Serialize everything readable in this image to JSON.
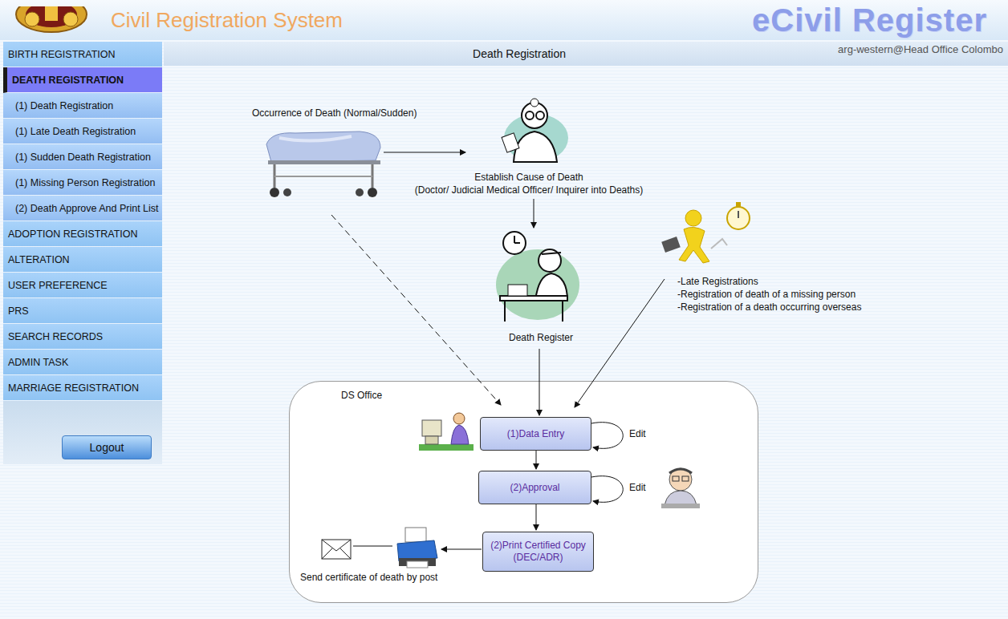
{
  "header": {
    "title": "Civil Registration System",
    "brand": "eCivil Register"
  },
  "sidebar": {
    "items": [
      {
        "label": "BIRTH REGISTRATION",
        "kind": "section",
        "selected": false
      },
      {
        "label": "DEATH REGISTRATION",
        "kind": "section",
        "selected": true
      },
      {
        "label": "(1) Death Registration",
        "kind": "sub",
        "selected": false
      },
      {
        "label": "(1) Late Death Registration",
        "kind": "sub",
        "selected": false
      },
      {
        "label": "(1) Sudden Death Registration",
        "kind": "sub",
        "selected": false
      },
      {
        "label": "(1) Missing Person Registration",
        "kind": "sub",
        "selected": false
      },
      {
        "label": "(2) Death Approve And Print List",
        "kind": "sub",
        "selected": false
      },
      {
        "label": "ADOPTION REGISTRATION",
        "kind": "section",
        "selected": false
      },
      {
        "label": "ALTERATION",
        "kind": "section",
        "selected": false
      },
      {
        "label": "USER PREFERENCE",
        "kind": "section",
        "selected": false
      },
      {
        "label": "PRS",
        "kind": "section",
        "selected": false
      },
      {
        "label": "SEARCH RECORDS",
        "kind": "section",
        "selected": false
      },
      {
        "label": "ADMIN TASK",
        "kind": "section",
        "selected": false
      },
      {
        "label": "MARRIAGE REGISTRATION",
        "kind": "section",
        "selected": false
      }
    ],
    "logout": "Logout"
  },
  "topbar": {
    "title": "Death Registration",
    "user": "arg-western@Head Office Colombo"
  },
  "diagram": {
    "occurrence": "Occurrence of Death (Normal/Sudden)",
    "cause": [
      "Establish Cause of Death",
      "(Doctor/ Judicial Medical Officer/ Inquirer into Deaths)"
    ],
    "register": "Death Register",
    "other_cases": [
      "-Late Registrations",
      "-Registration of death of a missing person",
      "-Registration of a death occurring overseas"
    ],
    "office": "DS Office",
    "steps": [
      {
        "lines": [
          "(1)Data Entry"
        ],
        "edit": "Edit"
      },
      {
        "lines": [
          "(2)Approval"
        ],
        "edit": "Edit"
      },
      {
        "lines": [
          "(2)Print Certified Copy",
          "(DEC/ADR)"
        ],
        "edit": ""
      }
    ],
    "post": "Send certificate of death by post"
  }
}
